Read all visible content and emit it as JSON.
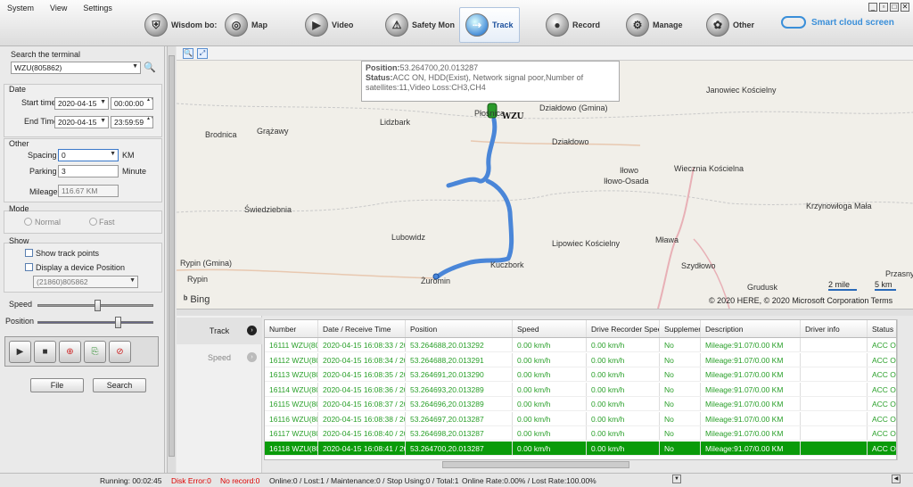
{
  "menu": [
    "System",
    "View",
    "Settings"
  ],
  "nav": [
    {
      "label": "Wisdom bo:",
      "icon": "shield-icon"
    },
    {
      "label": "Map",
      "icon": "map-icon"
    },
    {
      "label": "Video",
      "icon": "video-icon"
    },
    {
      "label": "Safety Mon",
      "icon": "safety-icon"
    },
    {
      "label": "Track",
      "icon": "track-icon"
    },
    {
      "label": "Record",
      "icon": "record-icon"
    },
    {
      "label": "Manage",
      "icon": "manage-icon"
    },
    {
      "label": "Other",
      "icon": "other-icon"
    }
  ],
  "brand": "Smart cloud screen",
  "left": {
    "search_title": "Search the terminal",
    "terminal": "WZU(805862)",
    "date_title": "Date",
    "start_label": "Start time",
    "start_date": "2020-04-15",
    "start_time": "00:00:00",
    "end_label": "End Time",
    "end_date": "2020-04-15",
    "end_time": "23:59:59",
    "other_title": "Other",
    "spacing_label": "Spacing",
    "spacing_value": "0",
    "spacing_unit": "KM",
    "parking_label": "Parking",
    "parking_value": "3",
    "parking_unit": "Minute",
    "mileage_label": "Mileage",
    "mileage_value": "116.67 KM",
    "mode_title": "Mode",
    "mode_normal": "Normal",
    "mode_fast": "Fast",
    "show_title": "Show",
    "show_track_points": "Show track points",
    "display_device_position": "Display a device Position",
    "device_select": "(21860)805862",
    "speed_label": "Speed",
    "position_label": "Position",
    "speed_level": 0.52,
    "position_level": 0.7,
    "file_button": "File",
    "search_button": "Search"
  },
  "map": {
    "popup_position_label": "Position:",
    "popup_position": "53.264700,20.013287",
    "popup_status_label": "Status:",
    "popup_status": "ACC ON, HDD(Exist), Network signal poor,Number of satellites:11,Video Loss:CH3,CH4",
    "vehicle_label": "WZU",
    "towns": [
      "Janowiec Kościelny",
      "Działdowo (Gmina)",
      "Lidzbark",
      "Płośnica",
      "Brodnica",
      "Grążawy",
      "Działdowo",
      "Iłowo",
      "Iłowo-Osada",
      "Wiecznia Kościelna",
      "Świedziebnia",
      "Krzynowłoga Mała",
      "Lubowidz",
      "Lipowiec Kościelny",
      "Mława",
      "Rypin (Gmina)",
      "Rypin",
      "Kuczbork",
      "Szydłowo",
      "Żuromin",
      "Grudusk",
      "Przasny"
    ],
    "bing": "Bing",
    "copyright": "© 2020 HERE, © 2020 Microsoft Corporation  Terms",
    "scale_mile": "2 mile",
    "scale_km": "5 km"
  },
  "tabs": [
    "Track",
    "Speed"
  ],
  "table": {
    "columns": [
      "Number",
      "Date / Receive Time",
      "Position",
      "Speed",
      "Drive Recorder Speed",
      "Supplement",
      "Description",
      "Driver info",
      "Status"
    ],
    "rows": [
      [
        "16111 WZU(80",
        "2020-04-15 16:08:33 / 20",
        "53.264688,20.013292",
        "0.00 km/h",
        "0.00 km/h",
        "No",
        "Mileage:91.07/0.00 KM",
        "",
        "ACC ON,"
      ],
      [
        "16112 WZU(80",
        "2020-04-15 16:08:34 / 20",
        "53.264688,20.013291",
        "0.00 km/h",
        "0.00 km/h",
        "No",
        "Mileage:91.07/0.00 KM",
        "",
        "ACC ON,"
      ],
      [
        "16113 WZU(80",
        "2020-04-15 16:08:35 / 20",
        "53.264691,20.013290",
        "0.00 km/h",
        "0.00 km/h",
        "No",
        "Mileage:91.07/0.00 KM",
        "",
        "ACC ON,"
      ],
      [
        "16114 WZU(80",
        "2020-04-15 16:08:36 / 20",
        "53.264693,20.013289",
        "0.00 km/h",
        "0.00 km/h",
        "No",
        "Mileage:91.07/0.00 KM",
        "",
        "ACC ON,"
      ],
      [
        "16115 WZU(80",
        "2020-04-15 16:08:37 / 20",
        "53.264696,20.013289",
        "0.00 km/h",
        "0.00 km/h",
        "No",
        "Mileage:91.07/0.00 KM",
        "",
        "ACC ON,"
      ],
      [
        "16116 WZU(80",
        "2020-04-15 16:08:38 / 20",
        "53.264697,20.013287",
        "0.00 km/h",
        "0.00 km/h",
        "No",
        "Mileage:91.07/0.00 KM",
        "",
        "ACC ON,"
      ],
      [
        "16117 WZU(80",
        "2020-04-15 16:08:40 / 20",
        "53.264698,20.013287",
        "0.00 km/h",
        "0.00 km/h",
        "No",
        "Mileage:91.07/0.00 KM",
        "",
        "ACC ON,"
      ],
      [
        "16118 WZU(80",
        "2020-04-15 16:08:41 / 20",
        "53.264700,20.013287",
        "0.00 km/h",
        "0.00 km/h",
        "No",
        "Mileage:91.07/0.00 KM",
        "",
        "ACC ON,"
      ]
    ],
    "selected_index": 7
  },
  "status": {
    "running": "Running: 00:02:45",
    "disk_error": "Disk Error:0",
    "no_record": "No record:0",
    "counts": "Online:0 / Lost:1 / Maintenance:0 / Stop Using:0 / Total:1",
    "rates": "Online Rate:0.00% / Lost Rate:100.00%"
  }
}
